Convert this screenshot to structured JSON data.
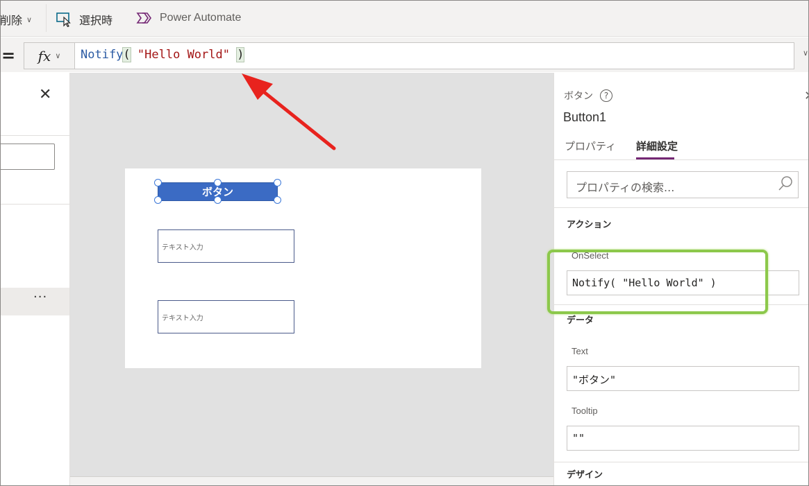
{
  "toolbar": {
    "delete_label": "削除",
    "select_label": "選択時",
    "power_automate_label": "Power Automate"
  },
  "formula_bar": {
    "equals": "=",
    "fx": "fx",
    "function_name": "Notify",
    "open_paren": "(",
    "string_value": "\"Hello World\"",
    "close_paren": ")"
  },
  "left_panel": {
    "more": "···"
  },
  "canvas": {
    "button_text": "ボタン",
    "text_input_1": "テキスト入力",
    "text_input_2": "テキスト入力"
  },
  "right_panel": {
    "control_type": "ボタン",
    "help": "?",
    "control_name": "Button1",
    "tabs": [
      "プロパティ",
      "詳細設定"
    ],
    "search_placeholder": "プロパティの検索...",
    "sections": {
      "action": "アクション",
      "data": "データ",
      "design": "デザイン"
    },
    "properties": {
      "onselect_label": "OnSelect",
      "onselect_value": "Notify( \"Hello World\" )",
      "text_label": "Text",
      "text_value": "\"ボタン\"",
      "tooltip_label": "Tooltip",
      "tooltip_value": "\"\""
    }
  },
  "colors": {
    "accent_tab": "#742774",
    "app_button": "#3b6bc4",
    "annotation_arrow": "#e8231e",
    "annotation_box": "#8cc84b"
  },
  "icons": [
    "chevron-down-icon",
    "select-cursor-icon",
    "power-automate-icon",
    "close-icon",
    "help-icon",
    "search-icon"
  ]
}
